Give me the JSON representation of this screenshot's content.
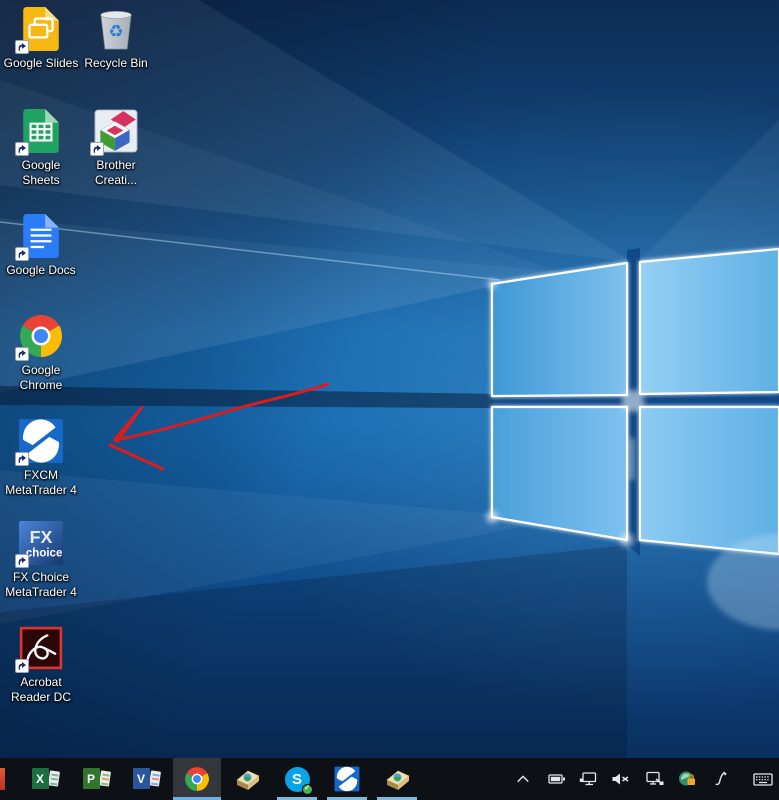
{
  "desktop": {
    "icons": [
      {
        "id": "google-slides",
        "line1": "Google Slides",
        "line2": ""
      },
      {
        "id": "recycle-bin",
        "line1": "Recycle Bin",
        "line2": "",
        "glyph": "♻"
      },
      {
        "id": "google-sheets",
        "line1": "Google",
        "line2": "Sheets"
      },
      {
        "id": "brother-creative-center",
        "line1": "Brother",
        "line2": "Creati..."
      },
      {
        "id": "google-docs",
        "line1": "Google Docs",
        "line2": ""
      },
      {
        "id": "google-chrome",
        "line1": "Google",
        "line2": "Chrome"
      },
      {
        "id": "fxcm-metatrader4",
        "line1": "FXCM",
        "line2": "MetaTrader 4"
      },
      {
        "id": "fxchoice-metatrader4",
        "line1": "FX Choice",
        "line2": "MetaTrader 4",
        "icon_text_top": "FX",
        "icon_text_bottom": "choice"
      },
      {
        "id": "acrobat-reader-dc",
        "line1": "Acrobat",
        "line2": "Reader DC"
      }
    ],
    "annotation": {
      "type": "hand-drawn-arrow",
      "color": "#df1b1b",
      "points_at": "FXCM MetaTrader 4"
    }
  },
  "taskbar": {
    "items": [
      {
        "name": "excel",
        "letter": "X",
        "active": false,
        "running": false
      },
      {
        "name": "project",
        "letter": "P",
        "active": false,
        "running": false
      },
      {
        "name": "visio",
        "letter": "V",
        "active": false,
        "running": false
      },
      {
        "name": "chrome",
        "letter": "",
        "active": true,
        "running": true
      },
      {
        "name": "metatrader4-gold",
        "letter": "",
        "active": false,
        "running": false
      },
      {
        "name": "skype",
        "letter": "S",
        "active": false,
        "running": true,
        "check": "✓"
      },
      {
        "name": "fxcm-metatrader4",
        "letter": "",
        "active": false,
        "running": true
      },
      {
        "name": "metatrader4-gold-2",
        "letter": "",
        "active": false,
        "running": true
      }
    ],
    "tray": [
      {
        "name": "chevron-up"
      },
      {
        "name": "battery"
      },
      {
        "name": "network-ethernet"
      },
      {
        "name": "volume-muted"
      },
      {
        "name": "safely-remove-hardware"
      },
      {
        "name": "secure-lock"
      },
      {
        "name": "windows-ink-pen"
      },
      {
        "name": "touch-keyboard"
      }
    ]
  },
  "colors": {
    "annotation_red": "#df1b1b",
    "taskbar_bg": "#0d1014",
    "running_underline": "#7fb9dc",
    "wallpaper_bright": "#7ec2ee",
    "wallpaper_dark": "#0d2c55"
  }
}
